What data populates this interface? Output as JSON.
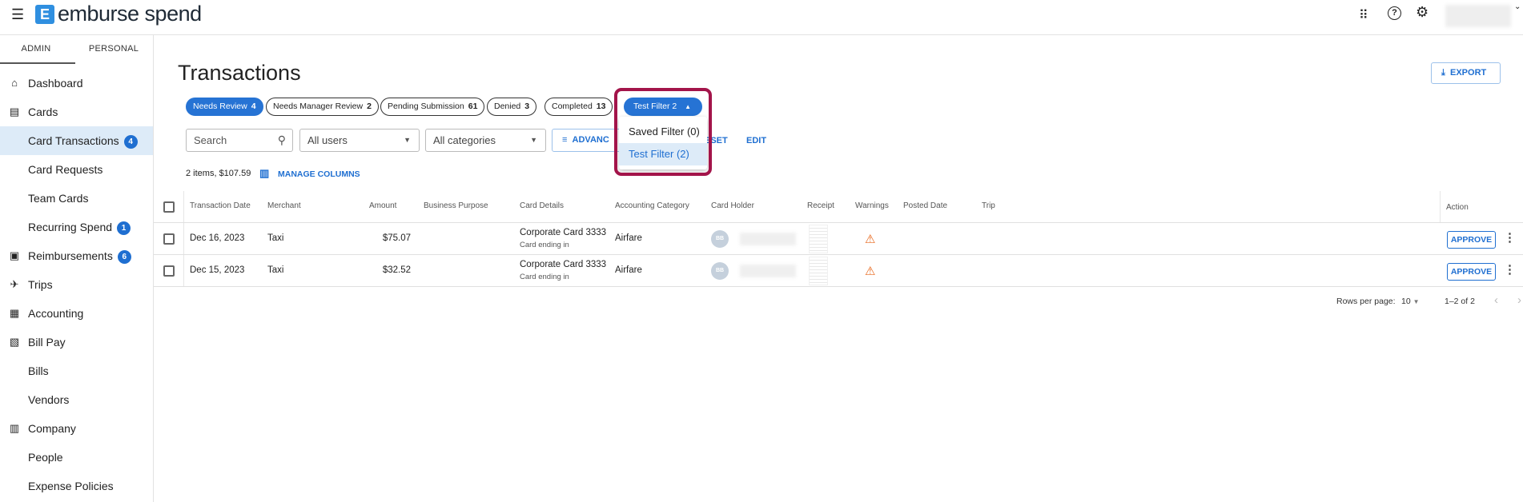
{
  "app": {
    "logo_text": "emburse spend",
    "logo_mark": "E"
  },
  "topbar": {
    "icons": [
      "menu-icon",
      "apps-grid-icon",
      "help-icon",
      "settings-icon",
      "chevron-down-icon"
    ]
  },
  "sidebar": {
    "tabs": [
      "ADMIN",
      "PERSONAL"
    ],
    "items": [
      {
        "label": "Dashboard",
        "icon": "home-icon"
      },
      {
        "label": "Cards",
        "icon": "cards-icon"
      },
      {
        "label": "Card Transactions",
        "badge": "4",
        "active": true
      },
      {
        "label": "Card Requests"
      },
      {
        "label": "Team Cards"
      },
      {
        "label": "Recurring Spend",
        "badge": "1"
      },
      {
        "label": "Reimbursements",
        "badge": "6",
        "icon": "money-icon"
      },
      {
        "label": "Trips",
        "icon": "airplane-icon"
      },
      {
        "label": "Accounting",
        "icon": "calculator-icon"
      },
      {
        "label": "Bill Pay",
        "icon": "bill-icon"
      },
      {
        "label": "Bills"
      },
      {
        "label": "Vendors"
      },
      {
        "label": "Company",
        "icon": "building-icon"
      },
      {
        "label": "People"
      },
      {
        "label": "Expense Policies"
      }
    ]
  },
  "main": {
    "title": "Transactions",
    "export_label": "EXPORT",
    "chips": [
      {
        "label": "Needs Review",
        "count": "4",
        "selected": true
      },
      {
        "label": "Needs Manager Review",
        "count": "2"
      },
      {
        "label": "Pending Submission",
        "count": "61"
      },
      {
        "label": "Denied",
        "count": "3"
      },
      {
        "label": "Completed",
        "count": "13"
      },
      {
        "label": "Test Filter 2",
        "selected": true
      }
    ],
    "filter_menu": {
      "items": [
        "Saved Filter (0)",
        "Test Filter (2)"
      ],
      "selected": "Test Filter (2)"
    },
    "search_placeholder": "Search",
    "users_select": "All users",
    "categories_select": "All categories",
    "advanced_label": "ADVANC",
    "reset_label": "ESET",
    "edit_label": "EDIT",
    "summary": "2 items, $107.59",
    "manage_columns": "MANAGE COLUMNS",
    "table": {
      "columns": [
        "Transaction Date",
        "Merchant",
        "Amount",
        "Business Purpose",
        "Card Details",
        "Accounting Category",
        "Card Holder",
        "Receipt",
        "Warnings",
        "Posted Date",
        "Trip",
        "Action"
      ],
      "rows": [
        {
          "date": "Dec 16, 2023",
          "merchant": "Taxi",
          "amount": "$75.07",
          "card": "Corporate Card 3333",
          "card_sub": "Card ending in",
          "category": "Airfare",
          "initials": "BB",
          "action": "APPROVE"
        },
        {
          "date": "Dec 15, 2023",
          "merchant": "Taxi",
          "amount": "$32.52",
          "card": "Corporate Card 3333",
          "card_sub": "Card ending in",
          "category": "Airfare",
          "initials": "BB",
          "action": "APPROVE"
        }
      ]
    },
    "pagination": {
      "rows_per_page_label": "Rows per page:",
      "rows_per_page": "10",
      "range": "1–2 of 2"
    }
  },
  "colors": {
    "accent": "#1f6fd1",
    "highlight": "#a3144a",
    "warning": "#e8671b"
  }
}
